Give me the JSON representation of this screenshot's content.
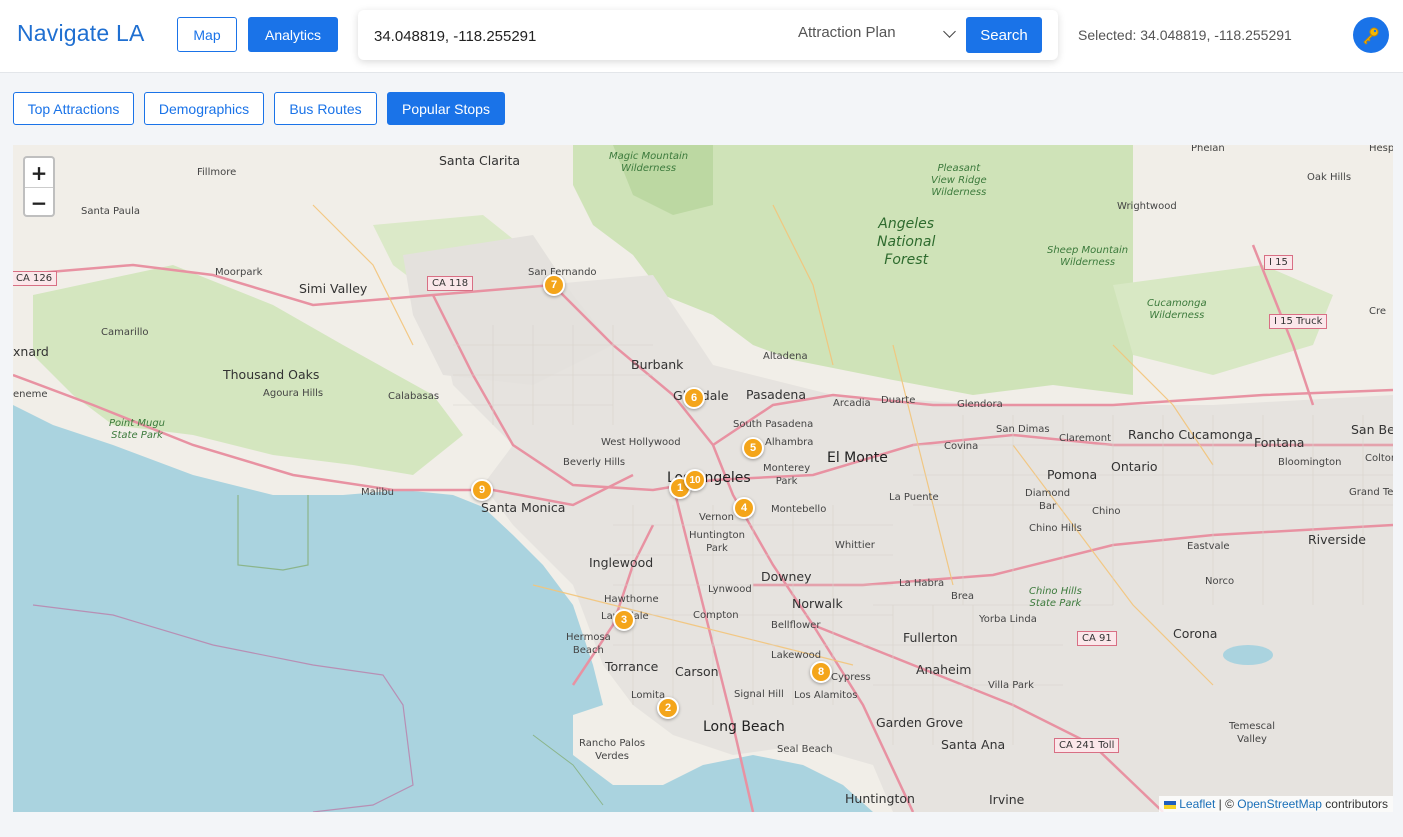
{
  "header": {
    "brand": "Navigate LA",
    "nav": {
      "map": "Map",
      "analytics": "Analytics"
    },
    "search": {
      "value": "34.048819, -118.255291",
      "plan_selected": "Attraction Plan",
      "button": "Search"
    },
    "selected_text": "Selected: 34.048819, -118.255291",
    "key_icon": "key-icon"
  },
  "tabs": [
    "Top Attractions",
    "Demographics",
    "Bus Routes",
    "Popular Stops"
  ],
  "active_tab": "Popular Stops",
  "map": {
    "zoom_in": "+",
    "zoom_out": "−",
    "markers": [
      "1",
      "2",
      "3",
      "4",
      "5",
      "6",
      "7",
      "8",
      "9",
      "10"
    ],
    "labels": {
      "santa_clarita": "Santa Clarita",
      "fillmore": "Fillmore",
      "santa_paula": "Santa Paula",
      "moorpark": "Moorpark",
      "simi_valley": "Simi Valley",
      "camarillo": "Camarillo",
      "oxnard": "xnard",
      "thousand_oaks": "Thousand Oaks",
      "agoura_hills": "Agoura Hills",
      "calabasas": "Calabasas",
      "san_fernando": "San Fernando",
      "burbank": "Burbank",
      "glendale": "Glendale",
      "pasadena": "Pasadena",
      "altadena": "Altadena",
      "south_pasadena": "South Pasadena",
      "alhambra": "Alhambra",
      "west_hollywood": "West Hollywood",
      "beverly_hills": "Beverly Hills",
      "los_angeles": "Los Angeles",
      "monterey_park": "Monterey\nPark",
      "el_monte": "El Monte",
      "malibu": "Malibu",
      "santa_monica": "Santa Monica",
      "vernon": "Vernon",
      "huntington_park": "Huntington\nPark",
      "montebello": "Montebello",
      "inglewood": "Inglewood",
      "hawthorne": "Hawthorne",
      "lawndale": "Lawndale",
      "hermosa_beach": "Hermosa\nBeach",
      "compton": "Compton",
      "lynwood": "Lynwood",
      "downey": "Downey",
      "whittier": "Whittier",
      "norwalk": "Norwalk",
      "bellflower": "Bellflower",
      "torrance": "Torrance",
      "carson": "Carson",
      "lomita": "Lomita",
      "lakewood": "Lakewood",
      "cypress": "Cypress",
      "los_alamitos": "Los Alamitos",
      "signal_hill": "Signal Hill",
      "long_beach": "Long Beach",
      "seal_beach": "Seal Beach",
      "rancho_palos_verdes": "Rancho Palos\nVerdes",
      "la_habra": "La Habra",
      "brea": "Brea",
      "fullerton": "Fullerton",
      "anaheim": "Anaheim",
      "yorba_linda": "Yorba Linda",
      "villa_park": "Villa Park",
      "garden_grove": "Garden Grove",
      "santa_ana": "Santa Ana",
      "huntington": "Huntington",
      "irvine": "Irvine",
      "arcadia": "Arcadia",
      "duarte": "Duarte",
      "glendora": "Glendora",
      "covina": "Covina",
      "la_puente": "La Puente",
      "san_dimas": "San Dimas",
      "claremont": "Claremont",
      "pomona": "Pomona",
      "diamond_bar": "Diamond\nBar",
      "chino_hills": "Chino Hills",
      "chino": "Chino",
      "ontario": "Ontario",
      "rancho_cucamonga": "Rancho Cucamonga",
      "fontana": "Fontana",
      "bloomington": "Bloomington",
      "colton": "Colton",
      "san_be": "San Be",
      "grand_ter": "Grand Ter",
      "eastvale": "Eastvale",
      "norco": "Norco",
      "riverside": "Riverside",
      "corona": "Corona",
      "temescal_valley": "Temescal\nValley",
      "phelan": "Phelan",
      "hesp": "Hesp",
      "oak_hills": "Oak Hills",
      "wrightwood": "Wrightwood",
      "crest": "Cre",
      "eneme": "eneme",
      "magic_mountain": "Magic Mountain\nWilderness",
      "pleasant_view": "Pleasant\nView Ridge\nWilderness",
      "angeles_forest": "Angeles\nNational\nForest",
      "sheep_mountain": "Sheep Mountain\nWilderness",
      "cucamonga": "Cucamonga\nWilderness",
      "point_mugu": "Point Mugu\nState Park",
      "chino_hills_sp": "Chino Hills\nState Park"
    },
    "shields": {
      "ca126": "CA 126",
      "ca118": "CA 118",
      "i15": "I 15",
      "i15truck": "I 15 Truck",
      "ca91": "CA 91",
      "ca241": "CA 241 Toll"
    },
    "attribution": {
      "leaflet": "Leaflet",
      "sep": " | © ",
      "osm": "OpenStreetMap",
      "contributors": " contributors"
    }
  }
}
